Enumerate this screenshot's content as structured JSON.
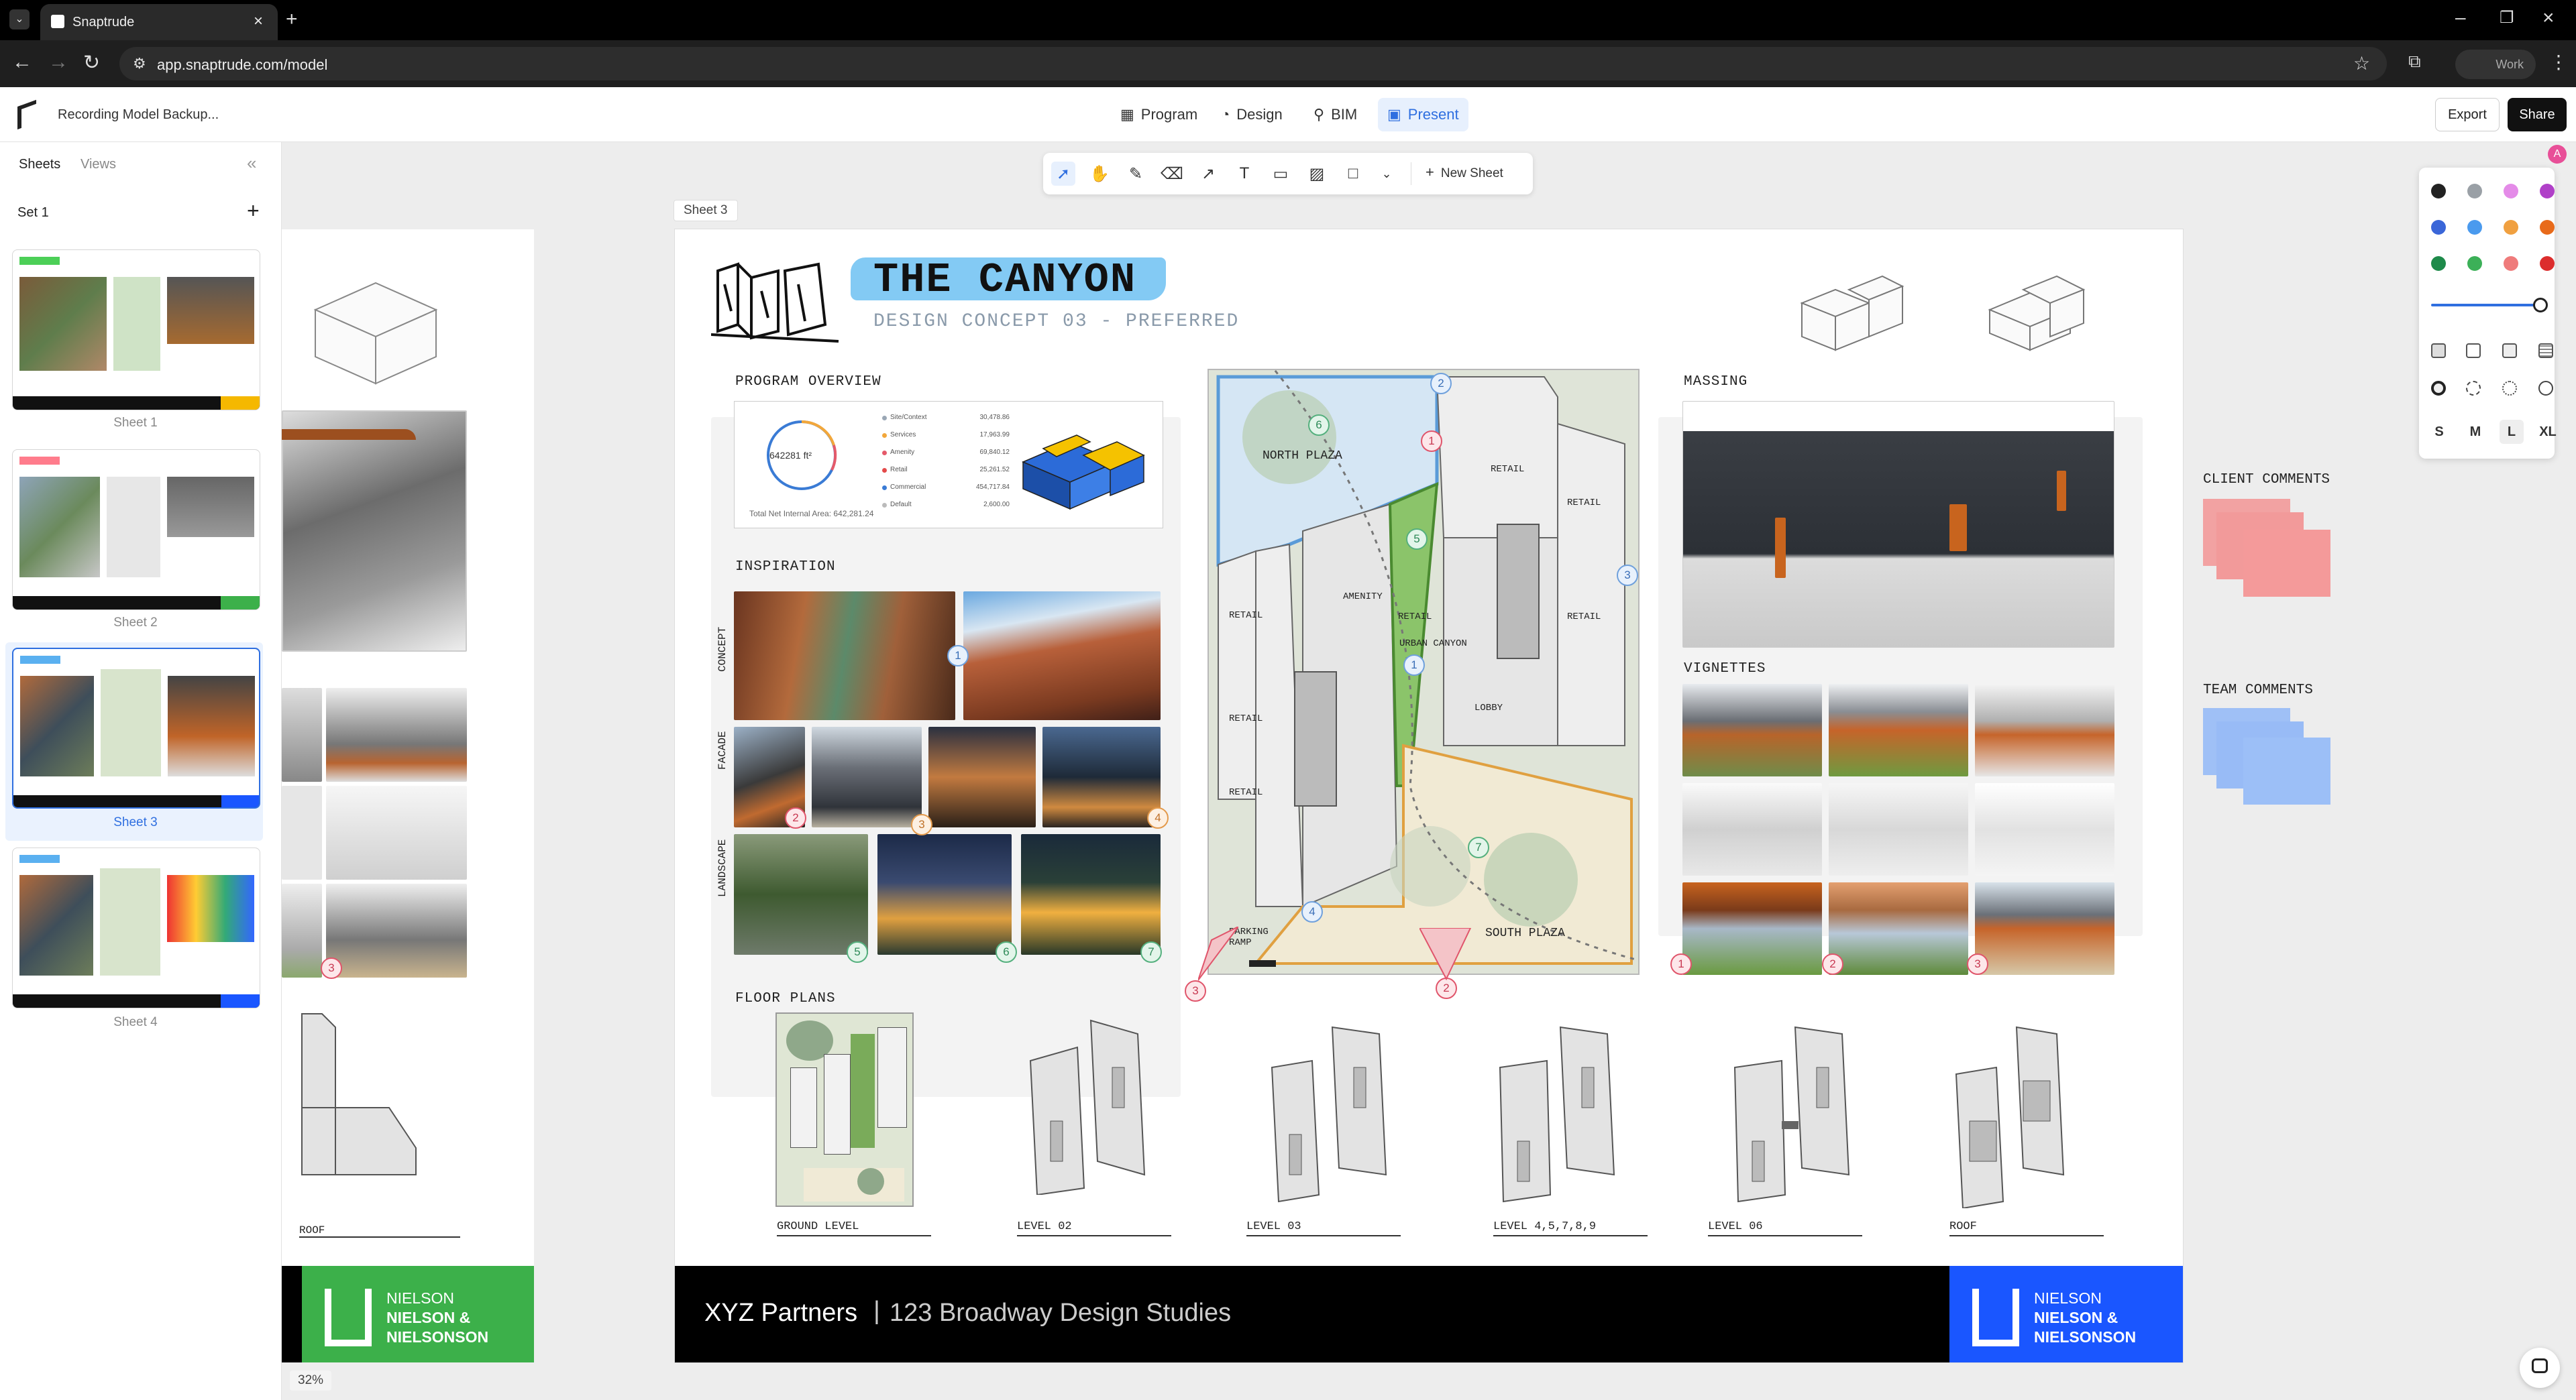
{
  "browser": {
    "tab_title": "Snaptrude",
    "url": "app.snaptrude.com/model",
    "profile_label": "Work"
  },
  "app": {
    "project_title": "Recording Model Backup...",
    "nav": [
      "Program",
      "Design",
      "BIM",
      "Present"
    ],
    "active_nav": "Present",
    "export_label": "Export",
    "share_label": "Share"
  },
  "sidebar": {
    "tabs": [
      "Sheets",
      "Views"
    ],
    "set_title": "Set 1",
    "sheets": [
      {
        "label": "Sheet 1"
      },
      {
        "label": "Sheet 2"
      },
      {
        "label": "Sheet 3"
      },
      {
        "label": "Sheet 4"
      }
    ],
    "selected": "Sheet 3"
  },
  "toolbar": {
    "new_sheet_label": "New Sheet"
  },
  "canvas": {
    "sheet_tag": "Sheet 3",
    "zoom": "32%",
    "user_avatar": "A"
  },
  "sheet": {
    "title": "THE CANYON",
    "subtitle": "DESIGN CONCEPT 03 - PREFERRED",
    "program_overview": {
      "heading": "PROGRAM OVERVIEW",
      "donut_value": "642281 ft²",
      "total_label": "Total Net Internal Area: 642,281.24",
      "rows": [
        {
          "name": "Site/Context",
          "value": "30,478.86"
        },
        {
          "name": "Services",
          "value": "17,963.99"
        },
        {
          "name": "Amenity",
          "value": "69,840.12"
        },
        {
          "name": "Retail",
          "value": "25,261.52"
        },
        {
          "name": "Commercial",
          "value": "454,717.84"
        },
        {
          "name": "Default",
          "value": "2,600.00"
        }
      ],
      "row_colors": [
        "#9aa7b5",
        "#f2a73b",
        "#e55a6a",
        "#e44a4a",
        "#3a7bd5",
        "#bbbbbb"
      ]
    },
    "inspiration": {
      "heading": "INSPIRATION",
      "side_labels": [
        "CONCEPT",
        "FACADE",
        "LANDSCAPE"
      ]
    },
    "site_plan": {
      "labels": [
        "NORTH PLAZA",
        "AMENITY",
        "RETAIL",
        "RETAIL",
        "RETAIL",
        "RETAIL",
        "URBAN CANYON",
        "LOBBY",
        "RETAIL",
        "RETAIL",
        "RETAIL",
        "PARKING RAMP",
        "SOUTH PLAZA"
      ]
    },
    "massing": {
      "heading": "MASSING"
    },
    "vignettes": {
      "heading": "VIGNETTES"
    },
    "floor_plans": {
      "heading": "FLOOR PLANS",
      "levels": [
        "GROUND LEVEL",
        "LEVEL 02",
        "LEVEL 03",
        "LEVEL 4,5,7,8,9",
        "LEVEL 06",
        "ROOF"
      ]
    },
    "footer": {
      "company": "XYZ Partners",
      "separator": "|",
      "project": "123 Broadway Design Studies"
    },
    "brand": {
      "line1": "NIELSON",
      "line2": "NIELSON &",
      "line3": "NIELSONSON"
    }
  },
  "prev_sheet": {
    "roof_label": "ROOF"
  },
  "comments": {
    "client": "CLIENT COMMENTS",
    "team": "TEAM COMMENTS"
  },
  "style_panel": {
    "colors": [
      "#222222",
      "#9aa0a6",
      "#e48be8",
      "#b040c8",
      "#3a66d8",
      "#4a9aee",
      "#f0a040",
      "#e86a1a",
      "#1e8a4a",
      "#3cb058",
      "#ef7b7b",
      "#dc2d2d"
    ],
    "sizes": [
      "S",
      "M",
      "L",
      "XL"
    ],
    "selected_size": "L"
  }
}
